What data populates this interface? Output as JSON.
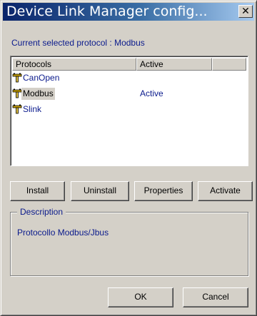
{
  "window": {
    "title": "Device Link Manager config...",
    "close_glyph": "✕"
  },
  "current_protocol_label": "Current selected protocol : Modbus",
  "protocols_list": {
    "columns": [
      "Protocols",
      "Active"
    ],
    "rows": [
      {
        "name": "CanOpen",
        "status": "",
        "selected": false,
        "icon": "network-plug-icon"
      },
      {
        "name": "Modbus",
        "status": "Active",
        "selected": true,
        "icon": "network-plug-icon"
      },
      {
        "name": "Slink",
        "status": "",
        "selected": false,
        "icon": "network-plug-icon"
      }
    ]
  },
  "buttons": {
    "install": "Install",
    "uninstall": "Uninstall",
    "properties": "Properties",
    "activate": "Activate",
    "ok": "OK",
    "cancel": "Cancel"
  },
  "description": {
    "title": "Description",
    "text": "Protocollo Modbus/Jbus"
  },
  "colors": {
    "title_gradient_start": "#0a246a",
    "title_gradient_end": "#a6caf0",
    "face": "#d4d0c8",
    "text_blue": "#0a1a8c"
  }
}
